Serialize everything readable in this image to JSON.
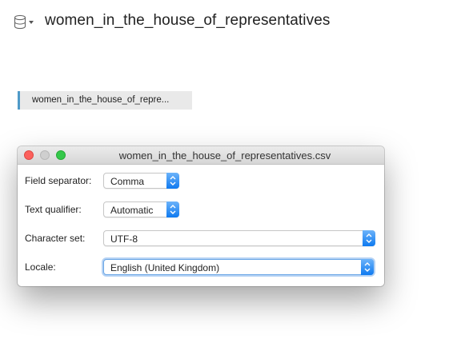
{
  "header": {
    "datasource_icon": "database-icon",
    "dropdown_icon": "chevron-down-icon",
    "title": "women_in_the_house_of_representatives"
  },
  "tab": {
    "label": "women_in_the_house_of_repre..."
  },
  "dialog": {
    "title": "women_in_the_house_of_representatives.csv",
    "fields": [
      {
        "label": "Field separator:",
        "value": "Comma"
      },
      {
        "label": "Text qualifier:",
        "value": "Automatic"
      },
      {
        "label": "Character set:",
        "value": "UTF-8"
      },
      {
        "label": "Locale:",
        "value": "English (United Kingdom)"
      }
    ]
  },
  "colors": {
    "accent": "#4f9ac8",
    "stepper_blue": "#0f7af0",
    "close": "#fc605c",
    "maximize": "#34c84a"
  }
}
